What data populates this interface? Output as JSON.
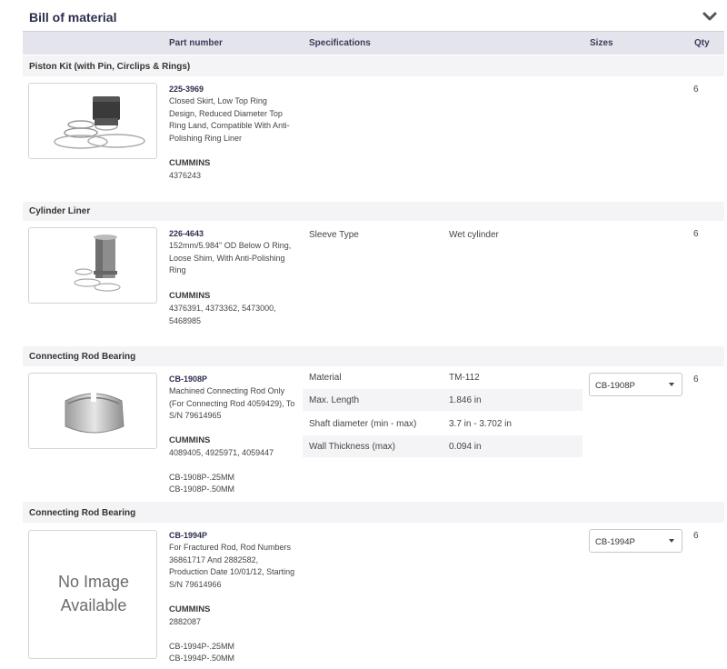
{
  "header": {
    "title": "Bill of material",
    "collapse_icon": "chevron-down-icon"
  },
  "columns": {
    "part_number": "Part number",
    "specifications": "Specifications",
    "sizes": "Sizes",
    "qty": "Qty"
  },
  "items": [
    {
      "section": "Piston Kit (with Pin, Circlips & Rings)",
      "image": "piston-kit-image",
      "part_number": "225-3969",
      "description": "Closed Skirt, Low Top Ring Design, Reduced Diameter Top Ring Land, Compatible With Anti-Polishing Ring Liner",
      "manufacturer": "CUMMINS",
      "mfr_numbers": "4376243",
      "qty": "6"
    },
    {
      "section": "Cylinder Liner",
      "image": "cylinder-liner-image",
      "part_number": "226-4643",
      "description": "152mm/5.984\" OD Below O Ring, Loose Shim, With Anti-Polishing Ring",
      "manufacturer": "CUMMINS",
      "mfr_numbers": "4376391, 4373362, 5473000, 5468985",
      "specs": [
        {
          "name": "Sleeve Type",
          "value": "Wet cylinder"
        }
      ],
      "qty": "6"
    },
    {
      "section": "Connecting Rod Bearing",
      "image": "rod-bearing-image",
      "part_number": "CB-1908P",
      "description": "Machined Connecting Rod Only (For Connecting Rod 4059429), To S/N 79614965",
      "manufacturer": "CUMMINS",
      "mfr_numbers": "4089405, 4925971, 4059447",
      "alternates": [
        "CB-1908P-.25MM",
        "CB-1908P-.50MM"
      ],
      "specs": [
        {
          "name": "Material",
          "value": "TM-112"
        },
        {
          "name": "Max. Length",
          "value": "1.846 in"
        },
        {
          "name": "Shaft diameter (min - max)",
          "value": "3.7 in - 3.702 in"
        },
        {
          "name": "Wall Thickness (max)",
          "value": "0.094 in"
        }
      ],
      "size_selected": "CB-1908P",
      "qty": "6"
    },
    {
      "section": "Connecting Rod Bearing",
      "no_image_line1": "No Image",
      "no_image_line2": "Available",
      "part_number": "CB-1994P",
      "description": "For Fractured Rod, Rod Numbers 36861717 And 2882582, Production Date 10/01/12, Starting S/N 79614966",
      "manufacturer": "CUMMINS",
      "mfr_numbers": "2882087",
      "alternates": [
        "CB-1994P-.25MM",
        "CB-1994P-.50MM"
      ],
      "size_selected": "CB-1994P",
      "qty": "6"
    }
  ]
}
